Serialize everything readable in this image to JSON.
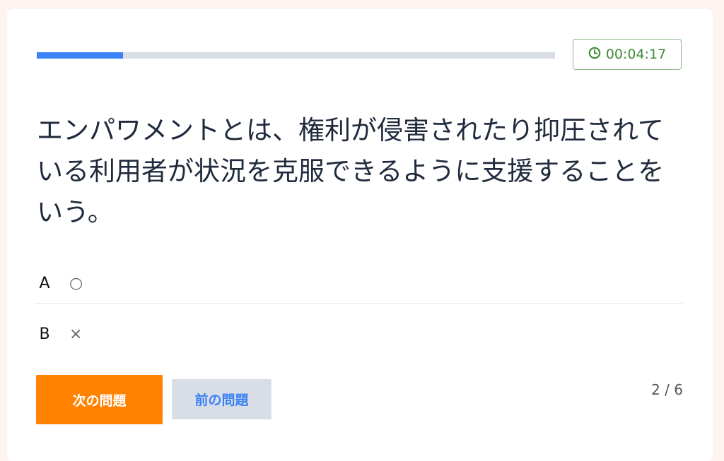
{
  "quiz": {
    "progress_fraction": 0.1667,
    "timer": {
      "icon": "clock-icon",
      "text": "00:04:17"
    },
    "question": "エンパワメントとは、権利が侵害されたり抑圧されている利用者が状況を克服できるように支援することをいう。",
    "options": [
      {
        "letter": "A",
        "text": "○"
      },
      {
        "letter": "B",
        "text": "×"
      }
    ],
    "buttons": {
      "next_label": "次の問題",
      "prev_label": "前の問題"
    },
    "page_counter": "2 / 6"
  },
  "colors": {
    "accent": "#3b82f6",
    "next_button": "#ff8200",
    "timer_green": "#3d8a35"
  }
}
